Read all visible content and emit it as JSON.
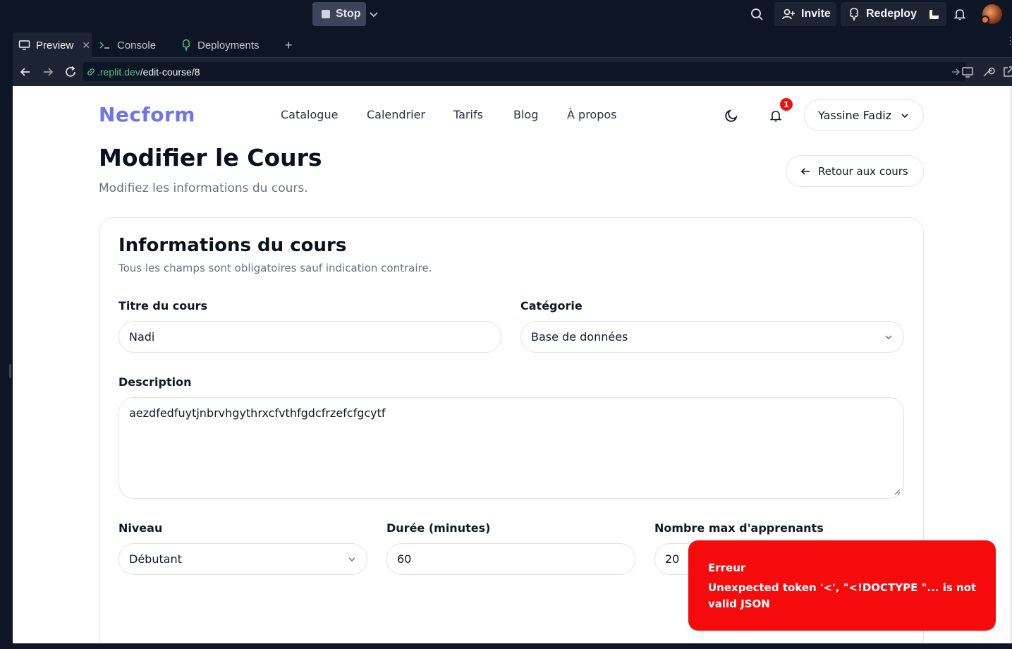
{
  "ide": {
    "stop_label": "Stop",
    "invite_label": "Invite",
    "redeploy_label": "Redeploy"
  },
  "tabs": [
    {
      "label": "Preview",
      "active": true
    },
    {
      "label": "Console",
      "active": false
    },
    {
      "label": "Deployments",
      "active": false
    }
  ],
  "url": {
    "host": ".replit.dev",
    "path": "/edit-course/8"
  },
  "site": {
    "logo": "Necform",
    "nav": [
      "Catalogue",
      "Calendrier",
      "Tarifs",
      "Blog",
      "À propos"
    ],
    "notification_count": "1",
    "user_name": "Yassine Fadiz"
  },
  "page": {
    "title": "Modifier le Cours",
    "subtitle": "Modifiez les informations du cours.",
    "back_label": "Retour aux cours"
  },
  "form": {
    "card_title": "Informations du cours",
    "card_subtitle": "Tous les champs sont obligatoires sauf indication contraire.",
    "title_label": "Titre du cours",
    "title_value": "Nadi",
    "category_label": "Catégorie",
    "category_value": "Base de données",
    "description_label": "Description",
    "description_value": "aezdfedfuytjnbrvhgythrxcfvthfgdcfrzefcfgcytf",
    "level_label": "Niveau",
    "level_value": "Débutant",
    "duration_label": "Durée (minutes)",
    "duration_value": "60",
    "max_label": "Nombre max d'apprenants",
    "max_value": "20"
  },
  "toast": {
    "title": "Erreur",
    "message": "Unexpected token '<', \"<!DOCTYPE \"... is not valid JSON"
  },
  "colors": {
    "ide_bg": "#0e1525",
    "logo": "#6e73f0",
    "toast_bg": "#f50b0b",
    "badge": "#ef1111"
  }
}
